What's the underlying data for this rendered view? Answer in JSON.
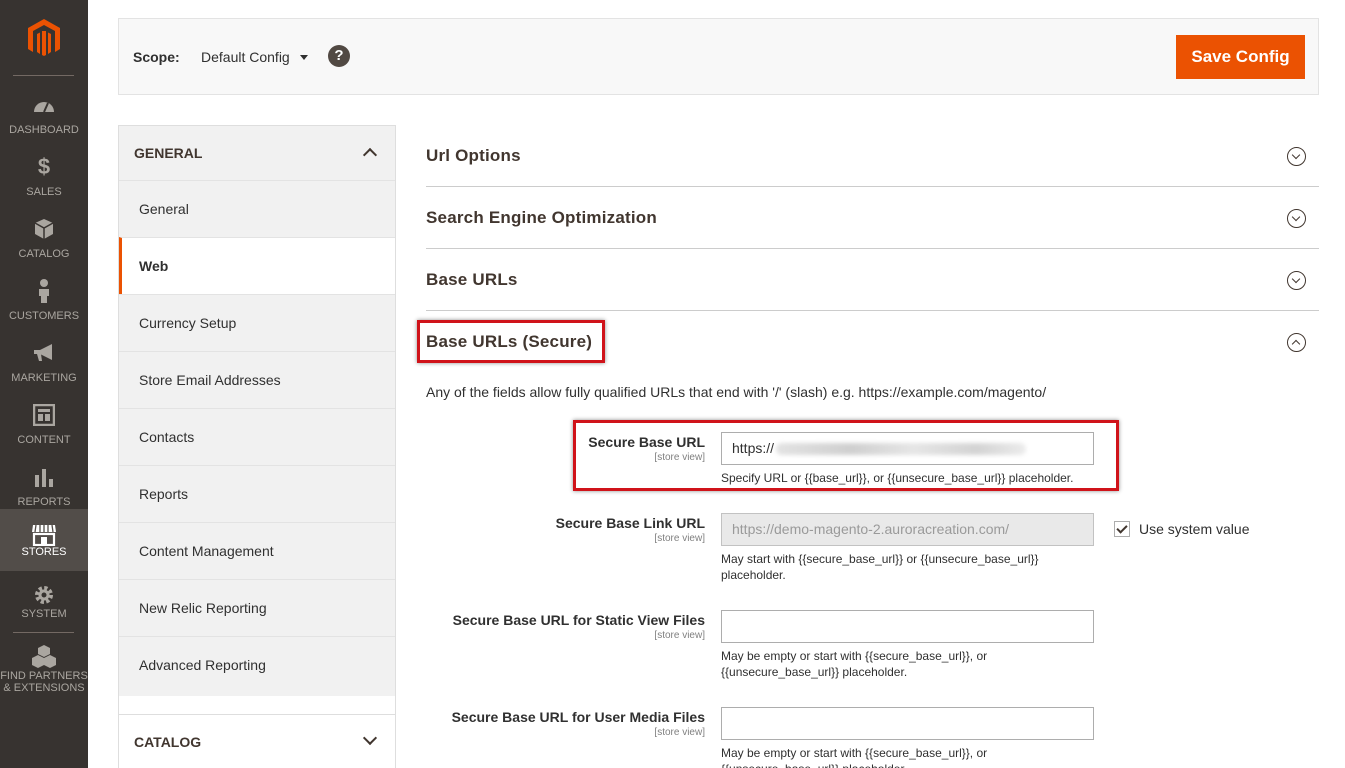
{
  "nav": {
    "items": [
      {
        "label": "Dashboard"
      },
      {
        "label": "Sales"
      },
      {
        "label": "Catalog"
      },
      {
        "label": "Customers"
      },
      {
        "label": "Marketing"
      },
      {
        "label": "Content"
      },
      {
        "label": "Reports"
      },
      {
        "label": "Stores"
      },
      {
        "label": "System"
      },
      {
        "label": "Find Partners",
        "label2": "& Extensions"
      }
    ],
    "active": "Stores"
  },
  "header": {
    "scope_label": "Scope:",
    "scope_value": "Default Config",
    "help_glyph": "?",
    "save_label": "Save Config"
  },
  "sidebar": {
    "general_head": "General",
    "items": [
      {
        "label": "General"
      },
      {
        "label": "Web"
      },
      {
        "label": "Currency Setup"
      },
      {
        "label": "Store Email Addresses"
      },
      {
        "label": "Contacts"
      },
      {
        "label": "Reports"
      },
      {
        "label": "Content Management"
      },
      {
        "label": "New Relic Reporting"
      },
      {
        "label": "Advanced Reporting"
      }
    ],
    "active_item": "Web",
    "catalog_head": "Catalog"
  },
  "sections": [
    {
      "title": "Url Options"
    },
    {
      "title": "Search Engine Optimization"
    },
    {
      "title": "Base URLs"
    },
    {
      "title": "Base URLs (Secure)"
    }
  ],
  "secure": {
    "description": "Any of the fields allow fully qualified URLs that end with '/' (slash) e.g. https://example.com/magento/",
    "fields": [
      {
        "label": "Secure Base URL",
        "scope": "[store view]",
        "value": "https://",
        "note": "Specify URL or {{base_url}}, or {{unsecure_base_url}} placeholder."
      },
      {
        "label": "Secure Base Link URL",
        "scope": "[store view]",
        "value": "https://demo-magento-2.auroracreation.com/",
        "note": "May start with {{secure_base_url}} or {{unsecure_base_url}} placeholder.",
        "system_value_label": "Use system value"
      },
      {
        "label": "Secure Base URL for Static View Files",
        "scope": "[store view]",
        "value": "",
        "note": "May be empty or start with {{secure_base_url}}, or {{unsecure_base_url}} placeholder."
      },
      {
        "label": "Secure Base URL for User Media Files",
        "scope": "[store view]",
        "value": "",
        "note": "May be empty or start with {{secure_base_url}}, or {{unsecure_base_url}} placeholder."
      }
    ]
  },
  "colors": {
    "nav_bg": "#373330",
    "accent": "#eb5202",
    "highlight": "#d0131a"
  }
}
